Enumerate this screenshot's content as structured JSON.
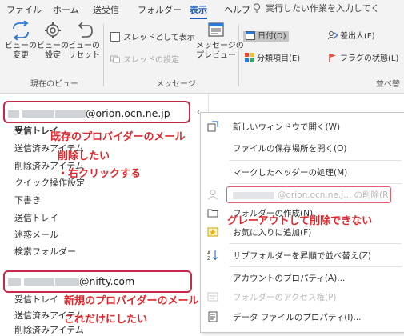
{
  "menu": {
    "tabs": [
      "ファイル",
      "ホーム",
      "送受信",
      "フォルダー",
      "表示",
      "ヘルプ"
    ],
    "active": "表示",
    "tellme": "実行したい作業を入力してく"
  },
  "ribbon": {
    "current_view": {
      "change_view": "ビューの\n変更",
      "view_settings": "ビューの\n設定",
      "reset_view": "ビューの\nリセット",
      "group_label": "現在のビュー"
    },
    "messages": {
      "thread_checkbox": "スレッドとして表示",
      "thread_settings": "スレッドの設定",
      "message_preview": "メッセージの\nプレビュー",
      "group_label": "メッセージ"
    },
    "arrangement": {
      "date": "日付(D)",
      "category": "分類項目(E)",
      "sender": "差出人(F)",
      "flag_status": "フラグの状態(L)",
      "group_label": "並べ替"
    }
  },
  "folders": {
    "account1": {
      "domain": "@orion.ocn.ne.jp"
    },
    "account1_folders": [
      "受信トレイ",
      "送信済みアイテム",
      "削除済みアイテム",
      "クイック操作設定",
      "下書き",
      "送信トレイ",
      "迷惑メール",
      "検索フォルダー"
    ],
    "account2": {
      "domain": "@nifty.com"
    },
    "account2_folders": [
      "受信トレイ",
      "送信済みアイテム",
      "削除済みアイテム"
    ]
  },
  "context_menu": {
    "items": [
      {
        "label": "新しいウィンドウで開く(W)",
        "icon": "new-window-icon",
        "enabled": true
      },
      {
        "label": "ファイルの保存場所を開く(O)",
        "icon": "",
        "enabled": true
      },
      {
        "label": "マークしたヘッダーの処理(M)",
        "icon": "",
        "enabled": true
      },
      {
        "label": "@orion.ocn.ne.j... の削除(R)",
        "icon": "person-icon",
        "enabled": false
      },
      {
        "label": "フォルダーの作成(N)",
        "icon": "folder-icon",
        "enabled": true
      },
      {
        "label": "お気に入りに追加(F)",
        "icon": "star-icon",
        "enabled": true
      },
      {
        "label": "サブフォルダーを昇順で並べ替え(Z)",
        "icon": "sort-az-icon",
        "enabled": true
      },
      {
        "label": "アカウントのプロパティ(A)...",
        "icon": "",
        "enabled": true
      },
      {
        "label": "フォルダーのアクセス権(P)",
        "icon": "access-icon",
        "enabled": false
      },
      {
        "label": "データ ファイルのプロパティ(I)...",
        "icon": "data-file-icon",
        "enabled": true
      }
    ]
  },
  "annotations": {
    "existing_mail": "既存のプロバイダーのメール",
    "want_delete": "削除したい",
    "right_click": "・右クリックする",
    "greyed_out": "グレーアウトして削除できない",
    "new_mail": "新規のプロバイダーのメール",
    "only_this": "これだけにしたい"
  },
  "colors": {
    "accent": "#185abd",
    "annotation": "#e0282c",
    "highlight_box": "#c8284a",
    "disabled_text": "#b8b8b8"
  }
}
